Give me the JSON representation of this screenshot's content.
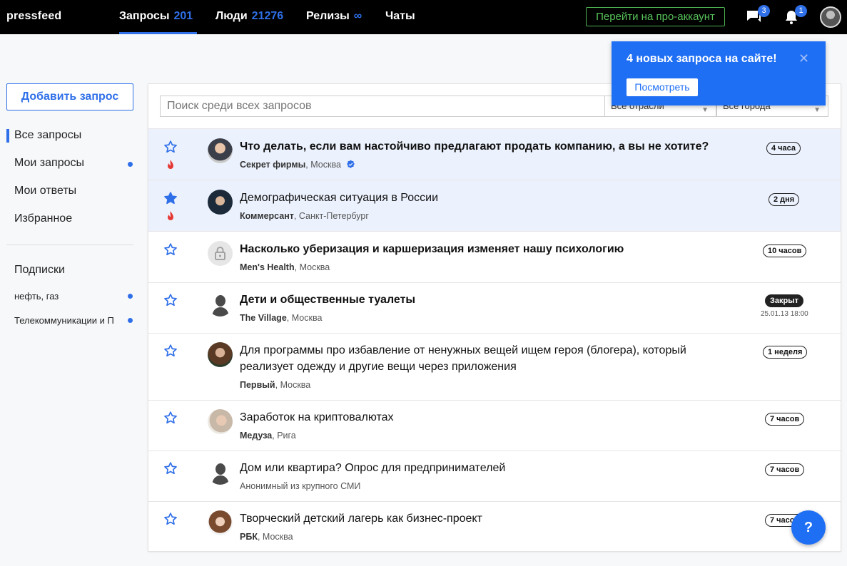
{
  "header": {
    "logo": "pressfeed",
    "tabs": [
      {
        "label": "Запросы",
        "count": "201"
      },
      {
        "label": "Люди",
        "count": "21276"
      },
      {
        "label": "Релизы",
        "count": "∞"
      },
      {
        "label": "Чаты",
        "count": ""
      }
    ],
    "pro_button": "Перейти на про-аккаунт",
    "messages_badge": "3",
    "notifications_badge": "1"
  },
  "sidebar": {
    "add_button": "Добавить запрос",
    "items": [
      "Все запросы",
      "Мои запросы",
      "Мои ответы",
      "Избранное"
    ],
    "subscriptions_title": "Подписки",
    "subscriptions": [
      "нефть, газ",
      "Телекоммуникации и П"
    ]
  },
  "filters": {
    "search_placeholder": "Поиск среди всех запросов",
    "industry": "Все отрасли",
    "city": "Все города"
  },
  "requests": [
    {
      "title": "Что делать, если вам настойчиво предлагают продать компанию, а вы не хотите?",
      "outlet": "Секрет фирмы",
      "city": "Москва",
      "time": "4 часа"
    },
    {
      "title": "Демографическая ситуация в России",
      "outlet": "Коммерсант",
      "city": "Санкт-Петербург",
      "time": "2 дня"
    },
    {
      "title": "Насколько уберизация и каршеризация изменяет нашу психологию",
      "outlet": "Men's Health",
      "city": "Москва",
      "time": "10 часов"
    },
    {
      "title": "Дети и общественные туалеты",
      "outlet": "The Village",
      "city": "Москва",
      "status": "Закрыт",
      "date": "25.01.13 18:00"
    },
    {
      "title": "Для программы про избавление от ненужных вещей ищем героя (блогера), который реализует одежду и другие вещи через приложения",
      "outlet": "Первый",
      "city": "Москва",
      "time": "1 неделя"
    },
    {
      "title": "Заработок на криптовалютах",
      "outlet": "Медуза",
      "city": "Рига",
      "time": "7 часов"
    },
    {
      "title": "Дом или квартира? Опрос для предпринимателей",
      "outlet": "Анонимный из крупного СМИ",
      "time": "7 часов"
    },
    {
      "title": "Творческий детский лагерь как бизнес-проект",
      "outlet": "РБК",
      "city": "Москва",
      "time": "7 часов"
    }
  ],
  "notification": {
    "text": "4 новых запроса на сайте!",
    "button": "Посмотреть"
  },
  "help_button": "?",
  "colors": {
    "accent": "#2f6fe8",
    "pro_green": "#57c25a",
    "highlight_row": "#ecf2fd",
    "fire": "#e53935"
  }
}
